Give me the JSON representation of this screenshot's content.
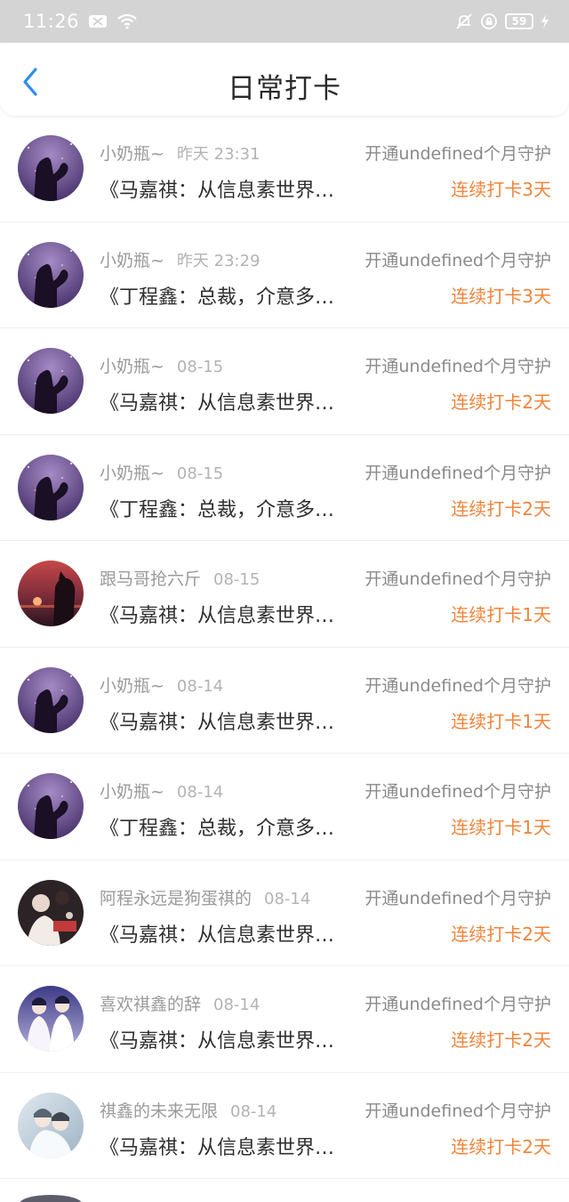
{
  "status_bar": {
    "time": "11:26",
    "battery": "59"
  },
  "header": {
    "title": "日常打卡"
  },
  "items": [
    {
      "user": "小奶瓶~",
      "time": "昨天 23:31",
      "guard": "开通undefined个月守护",
      "title": "《马嘉祺：从信息素世界…",
      "streak": "连续打卡3天",
      "avatar": "purple"
    },
    {
      "user": "小奶瓶~",
      "time": "昨天 23:29",
      "guard": "开通undefined个月守护",
      "title": "《丁程鑫：总裁，介意多…",
      "streak": "连续打卡3天",
      "avatar": "purple"
    },
    {
      "user": "小奶瓶~",
      "time": "08-15",
      "guard": "开通undefined个月守护",
      "title": "《马嘉祺：从信息素世界…",
      "streak": "连续打卡2天",
      "avatar": "purple"
    },
    {
      "user": "小奶瓶~",
      "time": "08-15",
      "guard": "开通undefined个月守护",
      "title": "《丁程鑫：总裁，介意多…",
      "streak": "连续打卡2天",
      "avatar": "purple"
    },
    {
      "user": "跟马哥抢六斤",
      "time": "08-15",
      "guard": "开通undefined个月守护",
      "title": "《马嘉祺：从信息素世界…",
      "streak": "连续打卡1天",
      "avatar": "sunset"
    },
    {
      "user": "小奶瓶~",
      "time": "08-14",
      "guard": "开通undefined个月守护",
      "title": "《马嘉祺：从信息素世界…",
      "streak": "连续打卡1天",
      "avatar": "purple"
    },
    {
      "user": "小奶瓶~",
      "time": "08-14",
      "guard": "开通undefined个月守护",
      "title": "《丁程鑫：总裁，介意多…",
      "streak": "连续打卡1天",
      "avatar": "purple"
    },
    {
      "user": "阿程永远是狗蛋祺的",
      "time": "08-14",
      "guard": "开通undefined个月守护",
      "title": "《马嘉祺：从信息素世界…",
      "streak": "连续打卡2天",
      "avatar": "dark"
    },
    {
      "user": "喜欢祺鑫的辞",
      "time": "08-14",
      "guard": "开通undefined个月守护",
      "title": "《马嘉祺：从信息素世界…",
      "streak": "连续打卡2天",
      "avatar": "pair"
    },
    {
      "user": "祺鑫的未来无限",
      "time": "08-14",
      "guard": "开通undefined个月守护",
      "title": "《马嘉祺：从信息素世界…",
      "streak": "连续打卡2天",
      "avatar": "pale"
    }
  ]
}
